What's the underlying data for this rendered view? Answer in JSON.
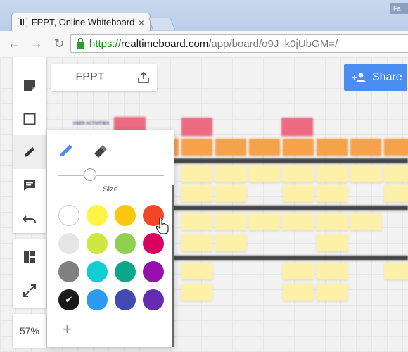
{
  "browser": {
    "tab_title": "FPPT, Online Whiteboard",
    "tab_close": "×",
    "fa_badge": "Fa",
    "minimize": "−",
    "url_scheme": "https://",
    "url_host": "realtimeboard.com",
    "url_path": "/app/board/o9J_k0jUbGM=/",
    "back": "←",
    "forward": "→",
    "reload": "↻"
  },
  "board": {
    "title": "FPPT",
    "share_label": "Share",
    "zoom": "57%",
    "label_text": "USER ACTIVITIES"
  },
  "left_tools": [
    "sticky-note",
    "rectangle",
    "pen",
    "comment",
    "undo"
  ],
  "left_tools2": [
    "templates",
    "fullscreen"
  ],
  "color_popup": {
    "size_label": "Size",
    "size_value": 0.3,
    "selected_color": "#1a1a1a",
    "add_label": "+",
    "colors": [
      [
        "#ffffff",
        "#fef445",
        "#fac710",
        "#f24726"
      ],
      [
        "#e6e6e6",
        "#cee741",
        "#8fd14f",
        "#da0063"
      ],
      [
        "#808080",
        "#12cdd4",
        "#0ca789",
        "#9510ac"
      ],
      [
        "#1a1a1a",
        "#2d9bf0",
        "#414bb2",
        "#652cb3"
      ]
    ]
  },
  "colors": {
    "accent": "#4a8ef2",
    "pen_active": "#4a8ef2"
  }
}
